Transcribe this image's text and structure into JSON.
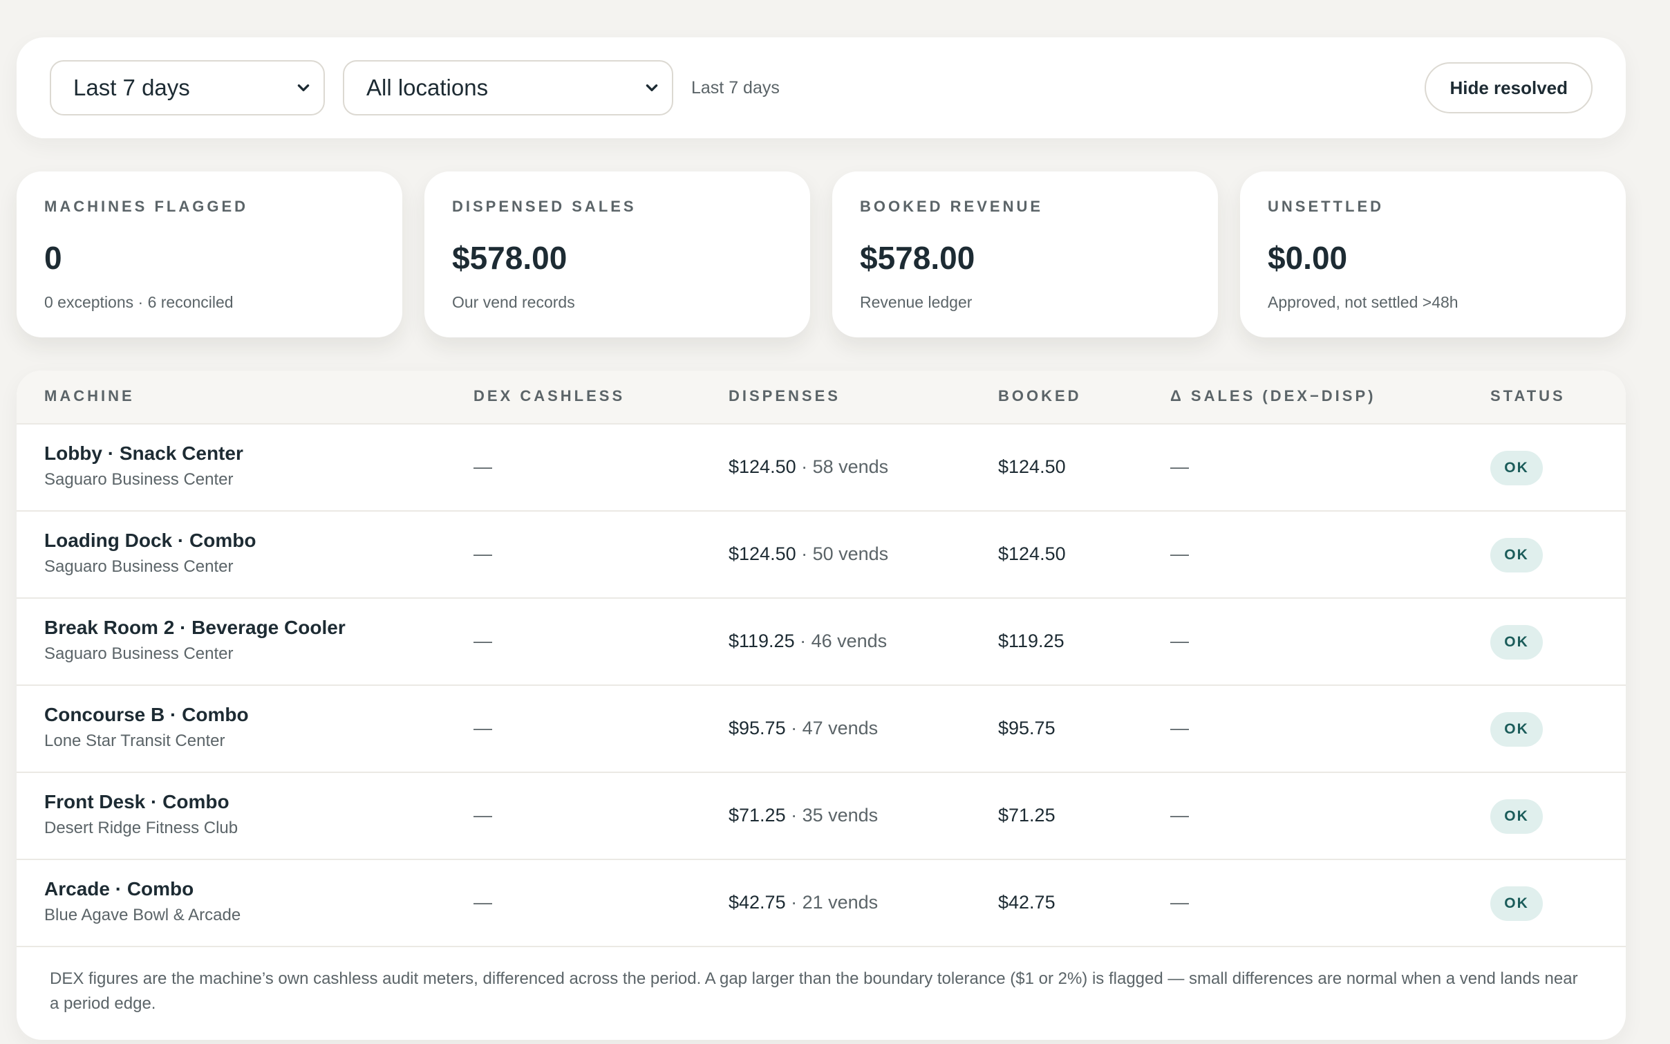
{
  "toolbar": {
    "range_select": "Last 7 days",
    "location_select": "All locations",
    "range_label": "Last 7 days",
    "hide_resolved": "Hide resolved"
  },
  "cards": [
    {
      "label": "MACHINES FLAGGED",
      "value": "0",
      "sub": "0 exceptions · 6 reconciled"
    },
    {
      "label": "DISPENSED SALES",
      "value": "$578.00",
      "sub": "Our vend records"
    },
    {
      "label": "BOOKED REVENUE",
      "value": "$578.00",
      "sub": "Revenue ledger"
    },
    {
      "label": "UNSETTLED",
      "value": "$0.00",
      "sub": "Approved, not settled >48h"
    }
  ],
  "table": {
    "columns": [
      "MACHINE",
      "DEX CASHLESS",
      "DISPENSES",
      "BOOKED",
      "Δ SALES (DEX−DISP)",
      "STATUS"
    ],
    "rows": [
      {
        "name": "Lobby · Snack Center",
        "location": "Saguaro Business Center",
        "dex": "—",
        "dispense_amount": "$124.50",
        "dispense_vends": " · 58 vends",
        "booked": "$124.50",
        "delta": "—",
        "status": "OK"
      },
      {
        "name": "Loading Dock · Combo",
        "location": "Saguaro Business Center",
        "dex": "—",
        "dispense_amount": "$124.50",
        "dispense_vends": " · 50 vends",
        "booked": "$124.50",
        "delta": "—",
        "status": "OK"
      },
      {
        "name": "Break Room 2 · Beverage Cooler",
        "location": "Saguaro Business Center",
        "dex": "—",
        "dispense_amount": "$119.25",
        "dispense_vends": " · 46 vends",
        "booked": "$119.25",
        "delta": "—",
        "status": "OK"
      },
      {
        "name": "Concourse B · Combo",
        "location": "Lone Star Transit Center",
        "dex": "—",
        "dispense_amount": "$95.75",
        "dispense_vends": " · 47 vends",
        "booked": "$95.75",
        "delta": "—",
        "status": "OK"
      },
      {
        "name": "Front Desk · Combo",
        "location": "Desert Ridge Fitness Club",
        "dex": "—",
        "dispense_amount": "$71.25",
        "dispense_vends": " · 35 vends",
        "booked": "$71.25",
        "delta": "—",
        "status": "OK"
      },
      {
        "name": "Arcade · Combo",
        "location": "Blue Agave Bowl & Arcade",
        "dex": "—",
        "dispense_amount": "$42.75",
        "dispense_vends": " · 21 vends",
        "booked": "$42.75",
        "delta": "—",
        "status": "OK"
      }
    ],
    "footnote": "DEX figures are the machine’s own cashless audit meters, differenced across the period. A gap larger than the boundary tolerance ($1 or 2%) is flagged — small differences are normal when a vend lands near a period edge."
  },
  "colors": {
    "background": "#f4f3f0",
    "badge_bg": "#e0efed",
    "badge_text": "#1b5c5a",
    "text": "#1d2b33",
    "muted": "#5b6468"
  }
}
